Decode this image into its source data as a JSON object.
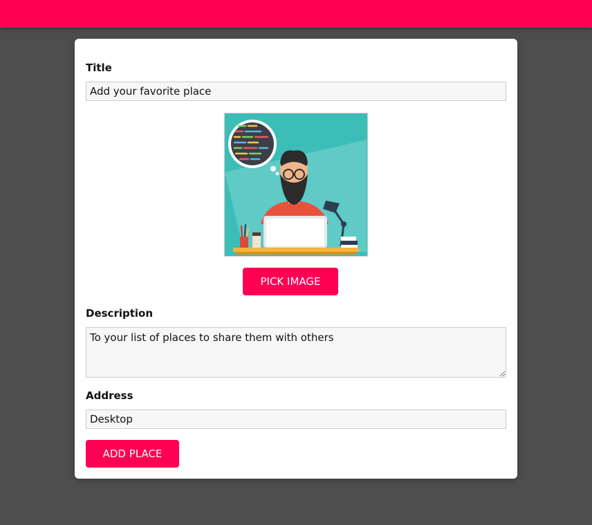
{
  "colors": {
    "accent": "#ff0055",
    "background": "#4d4d4d",
    "card": "#ffffff"
  },
  "form": {
    "title_label": "Title",
    "title_value": "Add your favorite place",
    "pick_image_button": "PICK IMAGE",
    "description_label": "Description",
    "description_value": "To your list of places to share them with others",
    "address_label": "Address",
    "address_value": "Desktop",
    "submit_button": "ADD PLACE"
  },
  "image_preview": {
    "subject": "developer-illustration"
  }
}
